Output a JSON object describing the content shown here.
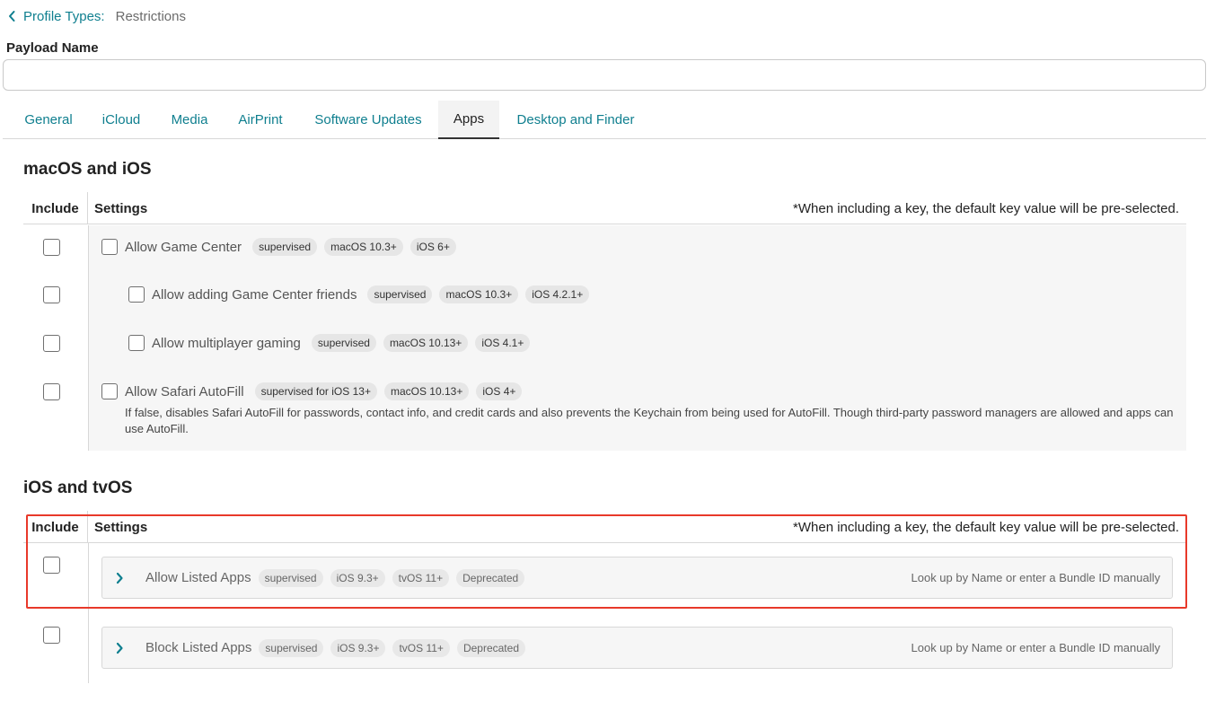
{
  "breadcrumb": {
    "link": "Profile Types:",
    "current": "Restrictions"
  },
  "payload": {
    "label": "Payload Name",
    "value": "",
    "placeholder": ""
  },
  "tabs": [
    {
      "label": "General"
    },
    {
      "label": "iCloud"
    },
    {
      "label": "Media"
    },
    {
      "label": "AirPrint"
    },
    {
      "label": "Software Updates"
    },
    {
      "label": "Apps",
      "active": true
    },
    {
      "label": "Desktop and Finder"
    }
  ],
  "sections": {
    "macos_ios": {
      "title": "macOS and iOS",
      "include_header": "Include",
      "settings_header": "Settings",
      "note": "*When including a key, the default key value will be pre-selected.",
      "rows": [
        {
          "label": "Allow Game Center",
          "badges": [
            "supervised",
            "macOS 10.3+",
            "iOS 6+"
          ]
        },
        {
          "label": "Allow adding Game Center friends",
          "badges": [
            "supervised",
            "macOS 10.3+",
            "iOS 4.2.1+"
          ]
        },
        {
          "label": "Allow multiplayer gaming",
          "badges": [
            "supervised",
            "macOS 10.13+",
            "iOS 4.1+"
          ]
        },
        {
          "label": "Allow Safari AutoFill",
          "badges": [
            "supervised for iOS 13+",
            "macOS 10.13+",
            "iOS 4+"
          ],
          "description": "If false, disables Safari AutoFill for passwords, contact info, and credit cards and also prevents the Keychain from being used for AutoFill. Though third-party password managers are allowed and apps can use AutoFill."
        }
      ]
    },
    "ios_tvos": {
      "title": "iOS and tvOS",
      "include_header": "Include",
      "settings_header": "Settings",
      "note": "*When including a key, the default key value will be pre-selected.",
      "rows": [
        {
          "label": "Allow Listed Apps",
          "badges": [
            "supervised",
            "iOS 9.3+",
            "tvOS 11+",
            "Deprecated"
          ],
          "hint": "Look up by Name or enter a Bundle ID manually"
        },
        {
          "label": "Block Listed Apps",
          "badges": [
            "supervised",
            "iOS 9.3+",
            "tvOS 11+",
            "Deprecated"
          ],
          "hint": "Look up by Name or enter a Bundle ID manually"
        }
      ]
    }
  },
  "colors": {
    "accent": "#0f7f8f",
    "highlight": "#e8392a"
  }
}
